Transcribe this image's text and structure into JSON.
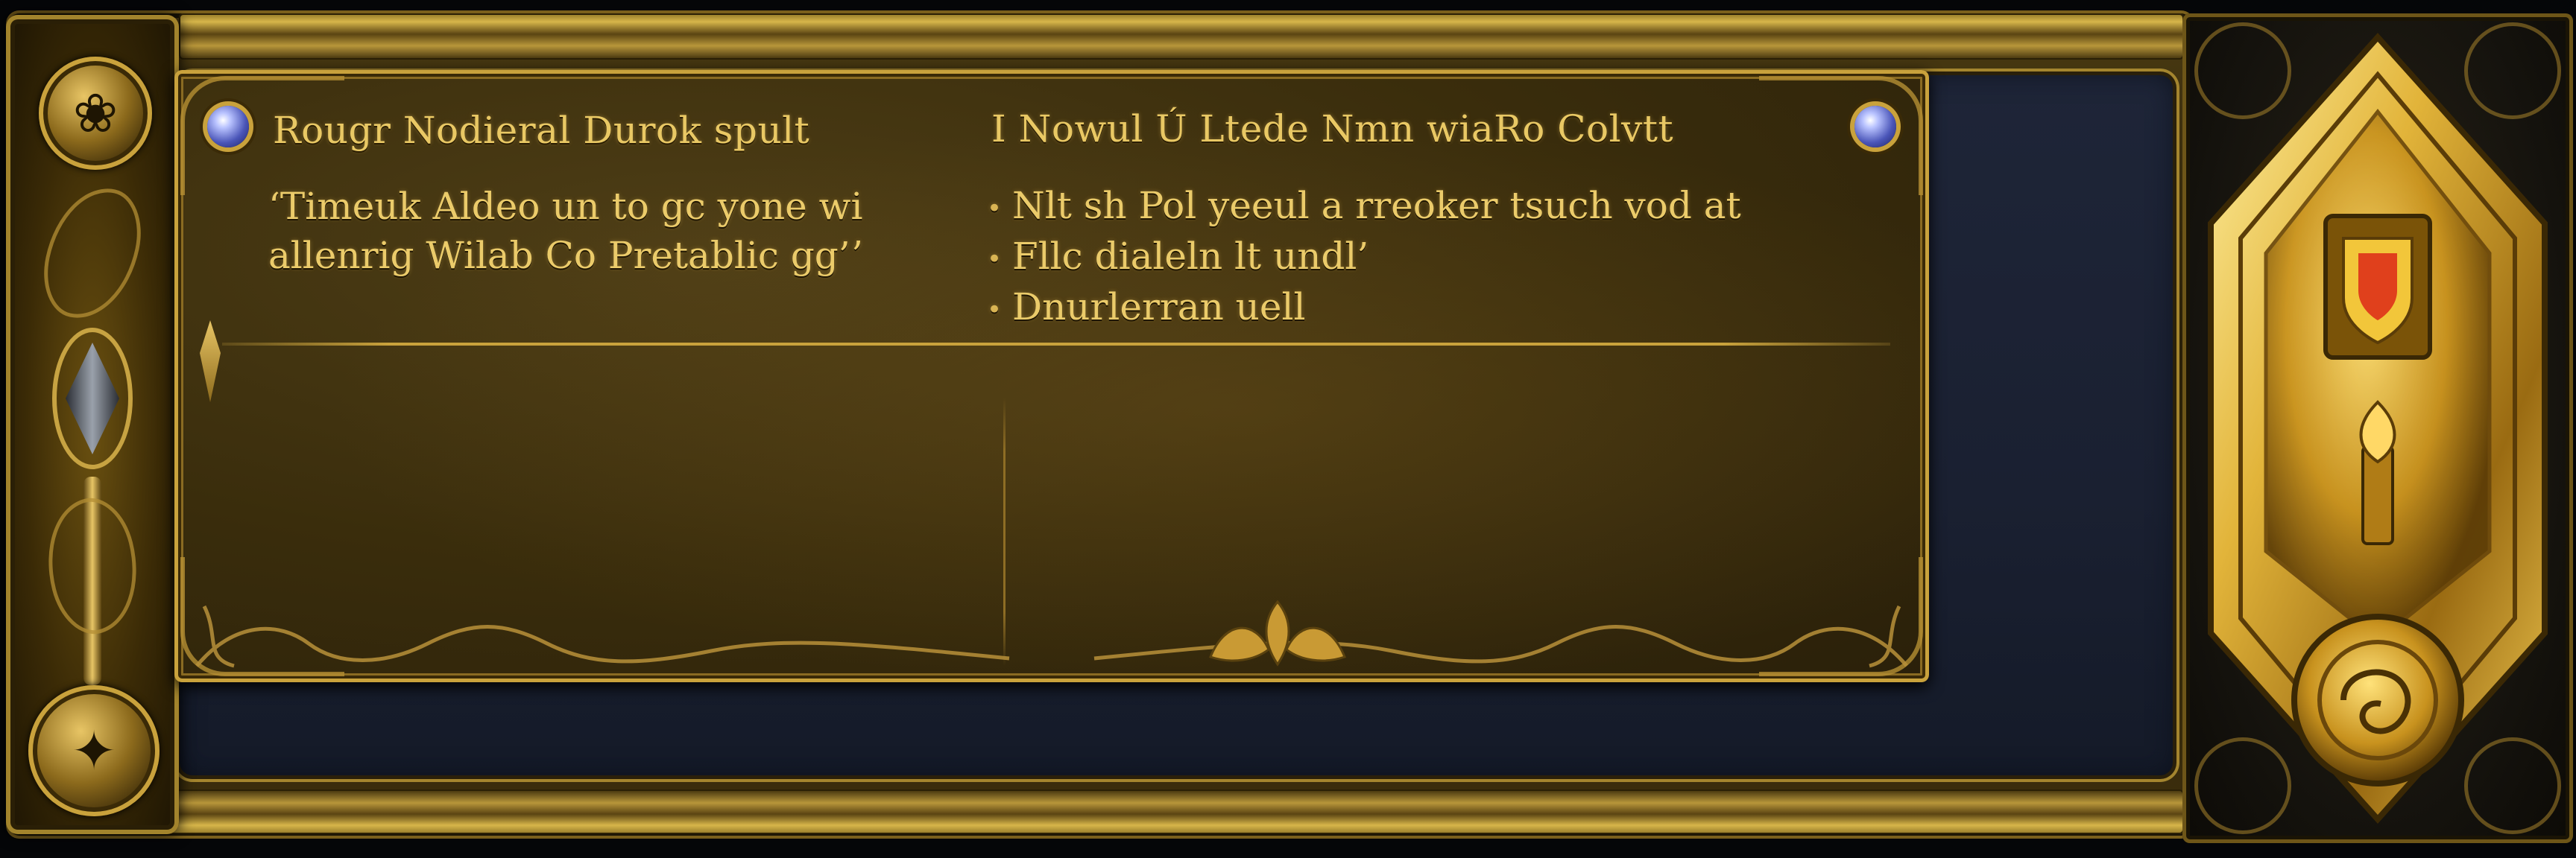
{
  "panel": {
    "left_column": {
      "title": "Rougr Nodieral Durok spult",
      "body_lines": [
        "ʻTimeuk Aldeo un to gc yone wi",
        "allenrig Wilab Co Pretablic gg’ʼ"
      ]
    },
    "right_column": {
      "title": "I Nowul Ú Ltede Nmn wiaRo Colvtt",
      "bullets": [
        "Nlt sh Pol yeeul a rreoker tsuch vod at",
        "Fllc dialeln lt undl’",
        "Dnurlerran uell"
      ]
    }
  },
  "icons": {
    "left_gem": "sapphire-gem-icon",
    "right_gem": "sapphire-gem-icon",
    "left_top_medallion": "dragon-head-icon",
    "left_bottom_medallion": "fleur-icon",
    "right_plaque_emblem": "shield-crest-icon",
    "right_plaque_medallion": "swirl-medallion-icon"
  },
  "colors": {
    "gold": "#c9a23c",
    "text_gold": "#ebcb6a",
    "panel_bg": "#3a2d0c",
    "navy": "#1e2538",
    "gem_blue": "#4a55b8",
    "crest_red": "#e0401c"
  }
}
